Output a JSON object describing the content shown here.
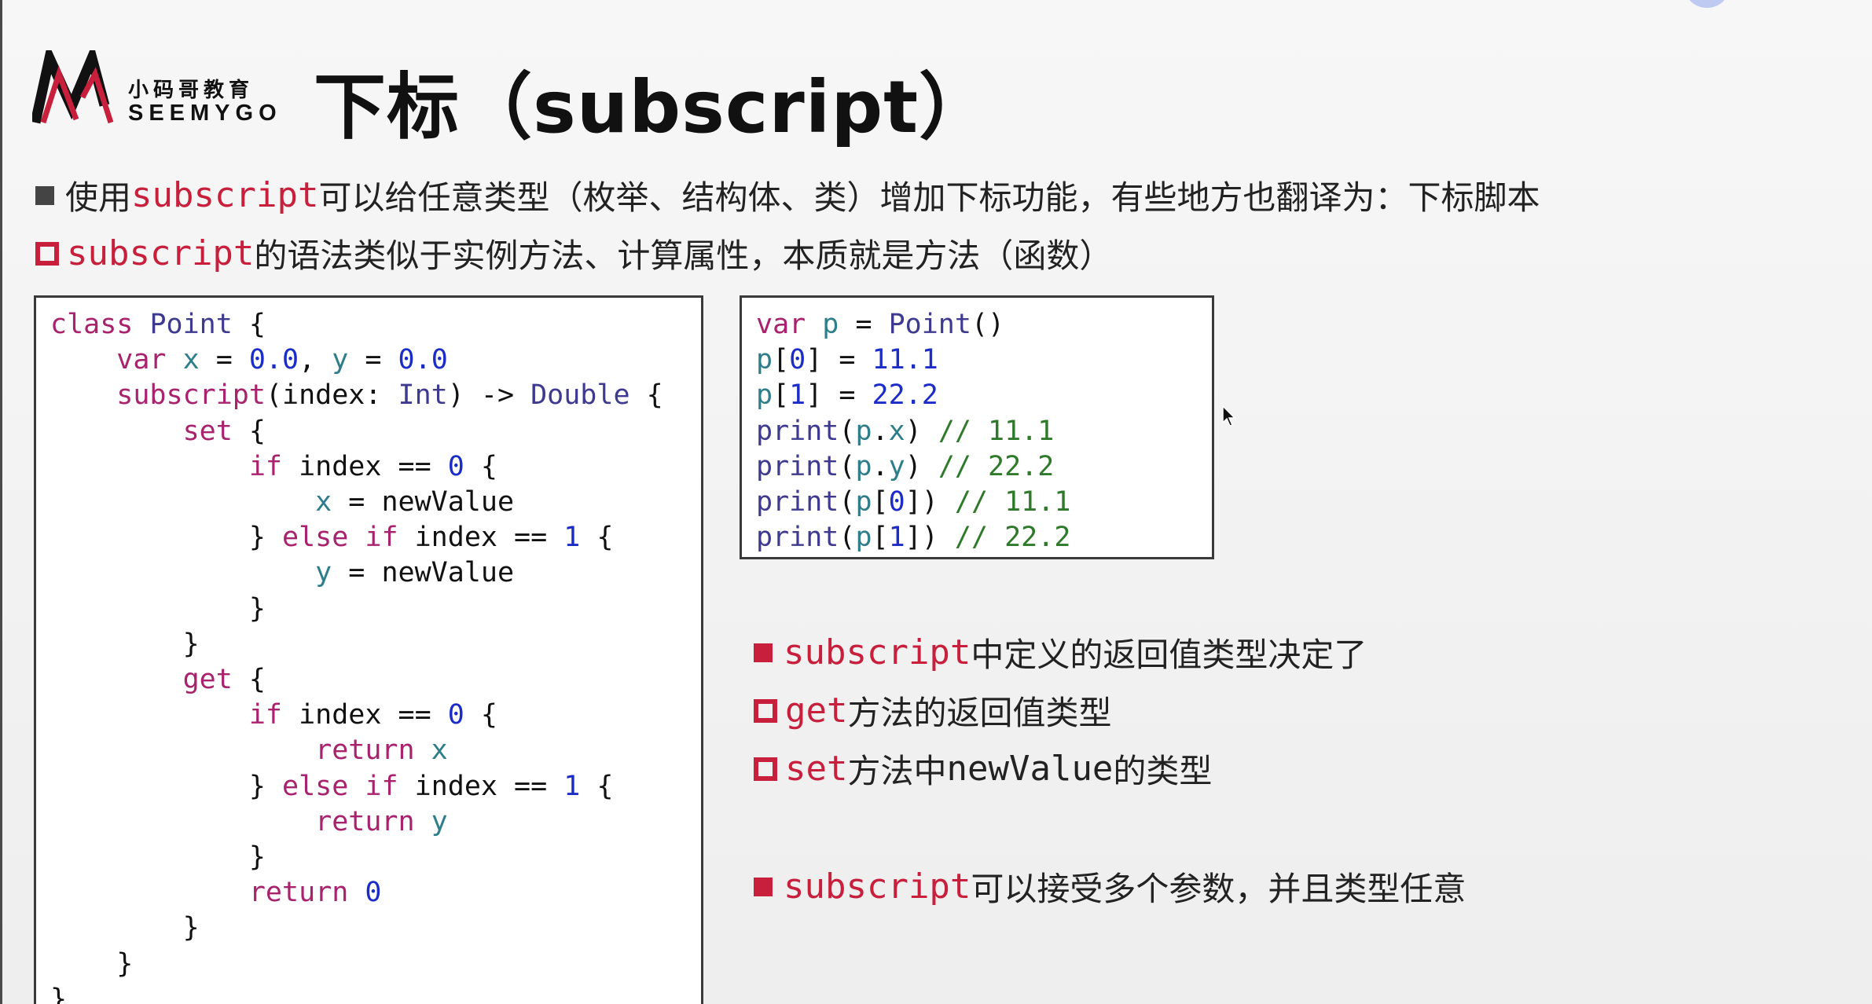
{
  "header": {
    "logo_cn": "小码哥教育",
    "logo_en": "SEEMYGO",
    "title": "下标（subscript）"
  },
  "colors": {
    "accent": "#c8203c",
    "bullet_gray": "#444444",
    "keyword": "#a8226e",
    "type": "#3d3a8f",
    "number": "#1b2cc8",
    "property": "#2d7d8a",
    "comment": "#2f7a2a"
  },
  "bullets": {
    "b1_kw": "subscript",
    "b1_text": "可以给任意类型（枚举、结构体、类）增加下标功能，有些地方也翻译为：下标脚本",
    "b1_pre": "使用",
    "b2_kw": "subscript",
    "b2_text": "的语法类似于实例方法、计算属性，本质就是方法（函数）",
    "b3_kw": "subscript",
    "b3_text": "中定义的返回值类型决定了",
    "b4_kw": "get",
    "b4_text": "方法的返回值类型",
    "b5_kw": "set",
    "b5_mid": "方法中",
    "b5_kw2": "newValue",
    "b5_text": "的类型",
    "b6_kw": "subscript",
    "b6_text": "可以接受多个参数，并且类型任意"
  },
  "code_left": [
    [
      [
        "class ",
        "kw"
      ],
      [
        "Point",
        "type"
      ],
      [
        " {",
        "plain"
      ]
    ],
    [
      [
        "    var ",
        "kw"
      ],
      [
        "x",
        "var"
      ],
      [
        " = ",
        "plain"
      ],
      [
        "0.0",
        "num"
      ],
      [
        ", ",
        "plain"
      ],
      [
        "y",
        "var"
      ],
      [
        " = ",
        "plain"
      ],
      [
        "0.0",
        "num"
      ]
    ],
    [
      [
        "    subscript",
        "kw"
      ],
      [
        "(index: ",
        "plain"
      ],
      [
        "Int",
        "type"
      ],
      [
        ") -> ",
        "plain"
      ],
      [
        "Double",
        "type"
      ],
      [
        " {",
        "plain"
      ]
    ],
    [
      [
        "        set",
        "kw"
      ],
      [
        " {",
        "plain"
      ]
    ],
    [
      [
        "            if",
        "kw"
      ],
      [
        " index == ",
        "plain"
      ],
      [
        "0",
        "num"
      ],
      [
        " {",
        "plain"
      ]
    ],
    [
      [
        "                x",
        "var"
      ],
      [
        " = newValue",
        "plain"
      ]
    ],
    [
      [
        "            } ",
        "plain"
      ],
      [
        "else if",
        "kw"
      ],
      [
        " index == ",
        "plain"
      ],
      [
        "1",
        "num"
      ],
      [
        " {",
        "plain"
      ]
    ],
    [
      [
        "                y",
        "var"
      ],
      [
        " = newValue",
        "plain"
      ]
    ],
    [
      [
        "            }",
        "plain"
      ]
    ],
    [
      [
        "        }",
        "plain"
      ]
    ],
    [
      [
        "        get",
        "kw"
      ],
      [
        " {",
        "plain"
      ]
    ],
    [
      [
        "            if",
        "kw"
      ],
      [
        " index == ",
        "plain"
      ],
      [
        "0",
        "num"
      ],
      [
        " {",
        "plain"
      ]
    ],
    [
      [
        "                return ",
        "kw"
      ],
      [
        "x",
        "var"
      ]
    ],
    [
      [
        "            } ",
        "plain"
      ],
      [
        "else if",
        "kw"
      ],
      [
        " index == ",
        "plain"
      ],
      [
        "1",
        "num"
      ],
      [
        " {",
        "plain"
      ]
    ],
    [
      [
        "                return ",
        "kw"
      ],
      [
        "y",
        "var"
      ]
    ],
    [
      [
        "            }",
        "plain"
      ]
    ],
    [
      [
        "            return ",
        "kw"
      ],
      [
        "0",
        "num"
      ]
    ],
    [
      [
        "        }",
        "plain"
      ]
    ],
    [
      [
        "    }",
        "plain"
      ]
    ],
    [
      [
        "}",
        "plain"
      ]
    ]
  ],
  "code_right": [
    [
      [
        "var ",
        "kw"
      ],
      [
        "p",
        "var"
      ],
      [
        " = ",
        "plain"
      ],
      [
        "Point",
        "type"
      ],
      [
        "()",
        "plain"
      ]
    ],
    [
      [
        "p",
        "var"
      ],
      [
        "[",
        "plain"
      ],
      [
        "0",
        "num"
      ],
      [
        "] = ",
        "plain"
      ],
      [
        "11.1",
        "num"
      ]
    ],
    [
      [
        "p",
        "var"
      ],
      [
        "[",
        "plain"
      ],
      [
        "1",
        "num"
      ],
      [
        "] = ",
        "plain"
      ],
      [
        "22.2",
        "num"
      ]
    ],
    [
      [
        "print",
        "type"
      ],
      [
        "(",
        "plain"
      ],
      [
        "p",
        "var"
      ],
      [
        ".",
        "plain"
      ],
      [
        "x",
        "var"
      ],
      [
        ") ",
        "plain"
      ],
      [
        "// 11.1",
        "cmt"
      ]
    ],
    [
      [
        "print",
        "type"
      ],
      [
        "(",
        "plain"
      ],
      [
        "p",
        "var"
      ],
      [
        ".",
        "plain"
      ],
      [
        "y",
        "var"
      ],
      [
        ") ",
        "plain"
      ],
      [
        "// 22.2",
        "cmt"
      ]
    ],
    [
      [
        "print",
        "type"
      ],
      [
        "(",
        "plain"
      ],
      [
        "p",
        "var"
      ],
      [
        "[",
        "plain"
      ],
      [
        "0",
        "num"
      ],
      [
        "]) ",
        "plain"
      ],
      [
        "// 11.1",
        "cmt"
      ]
    ],
    [
      [
        "print",
        "type"
      ],
      [
        "(",
        "plain"
      ],
      [
        "p",
        "var"
      ],
      [
        "[",
        "plain"
      ],
      [
        "1",
        "num"
      ],
      [
        "]) ",
        "plain"
      ],
      [
        "// 22.2",
        "cmt"
      ]
    ]
  ]
}
